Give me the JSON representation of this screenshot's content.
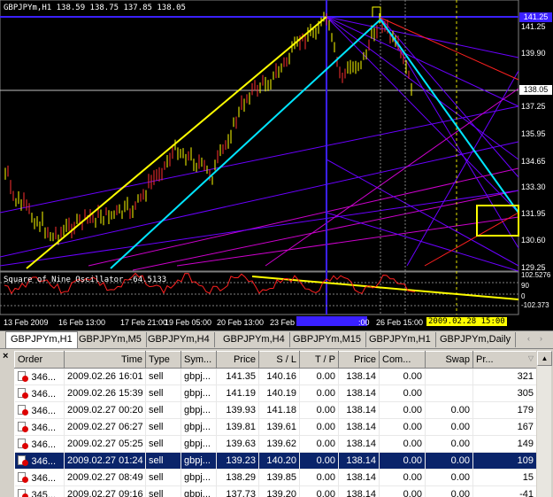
{
  "chart": {
    "header": "GBPJPYm,H1  138.59 138.75 137.85 138.05",
    "oscillator_label": "Square of Nine Oscillator -64.5133",
    "price_ticks": [
      "141.25",
      "139.90",
      "137.25",
      "135.95",
      "134.65",
      "133.30",
      "131.95",
      "130.60",
      "129.25"
    ],
    "current_price": "138.05",
    "top_price_box": "141.25",
    "osc_ticks": [
      "102.5276",
      "90",
      "0",
      "-102.373"
    ],
    "date_ticks": [
      "13 Feb 2009",
      "16 Feb 13:00",
      "17 Feb 21:00",
      "19 Feb 05:00",
      "20 Feb 13:00",
      "23 Feb",
      ":00",
      "26 Feb 15:00"
    ],
    "cursor_date": "2009.02.28 15:00",
    "colors": {
      "support": "#ffff00",
      "trend": "#00e5ff",
      "fan": "#6a00ff",
      "fan2": "#cc00cc",
      "red": "#ff2020",
      "up_candle": "#ff3030",
      "down_candle": "#ffff00"
    }
  },
  "tabs": {
    "items": [
      "GBPJPYm,H1",
      "GBPJPYm,M5",
      "GBPJPYm,H4",
      "GBPJPYm,H4",
      "GBPJPYm,M15",
      "GBPJPYm,H1",
      "GBPJPYm,Daily"
    ],
    "prev_arrow": "‹",
    "next_arrow": "›"
  },
  "terminal": {
    "close_label": "×",
    "columns": [
      "Order",
      "Time",
      "Type",
      "Sym...",
      "Price",
      "S / L",
      "T / P",
      "Price",
      "Com...",
      "Swap",
      "Pr..."
    ],
    "rows": [
      {
        "order": "346...",
        "time": "2009.02.26 16:01",
        "type": "sell",
        "sym": "gbpj...",
        "price": "141.35",
        "sl": "140.16",
        "tp": "0.00",
        "cur": "138.14",
        "com": "0.00",
        "swap": "",
        "profit": "321"
      },
      {
        "order": "346...",
        "time": "2009.02.26 15:39",
        "type": "sell",
        "sym": "gbpj...",
        "price": "141.19",
        "sl": "140.19",
        "tp": "0.00",
        "cur": "138.14",
        "com": "0.00",
        "swap": "",
        "profit": "305"
      },
      {
        "order": "346...",
        "time": "2009.02.27 00:20",
        "type": "sell",
        "sym": "gbpj...",
        "price": "139.93",
        "sl": "141.18",
        "tp": "0.00",
        "cur": "138.14",
        "com": "0.00",
        "swap": "0.00",
        "profit": "179"
      },
      {
        "order": "346...",
        "time": "2009.02.27 06:27",
        "type": "sell",
        "sym": "gbpj...",
        "price": "139.81",
        "sl": "139.61",
        "tp": "0.00",
        "cur": "138.14",
        "com": "0.00",
        "swap": "0.00",
        "profit": "167"
      },
      {
        "order": "346...",
        "time": "2009.02.27 05:25",
        "type": "sell",
        "sym": "gbpj...",
        "price": "139.63",
        "sl": "139.62",
        "tp": "0.00",
        "cur": "138.14",
        "com": "0.00",
        "swap": "0.00",
        "profit": "149"
      },
      {
        "order": "346...",
        "time": "2009.02.27 01:24",
        "type": "sell",
        "sym": "gbpj...",
        "price": "139.23",
        "sl": "140.20",
        "tp": "0.00",
        "cur": "138.14",
        "com": "0.00",
        "swap": "0.00",
        "profit": "109"
      },
      {
        "order": "346...",
        "time": "2009.02.27 08:49",
        "type": "sell",
        "sym": "gbpj...",
        "price": "138.29",
        "sl": "139.85",
        "tp": "0.00",
        "cur": "138.14",
        "com": "0.00",
        "swap": "0.00",
        "profit": "15"
      },
      {
        "order": "345...",
        "time": "2009.02.27 09:16",
        "type": "sell",
        "sym": "gbpj...",
        "price": "137.73",
        "sl": "139.20",
        "tp": "0.00",
        "cur": "138.14",
        "com": "0.00",
        "swap": "0.00",
        "profit": "-41"
      }
    ],
    "selected_row_index": 5,
    "scroll_up_icon": "▲"
  }
}
